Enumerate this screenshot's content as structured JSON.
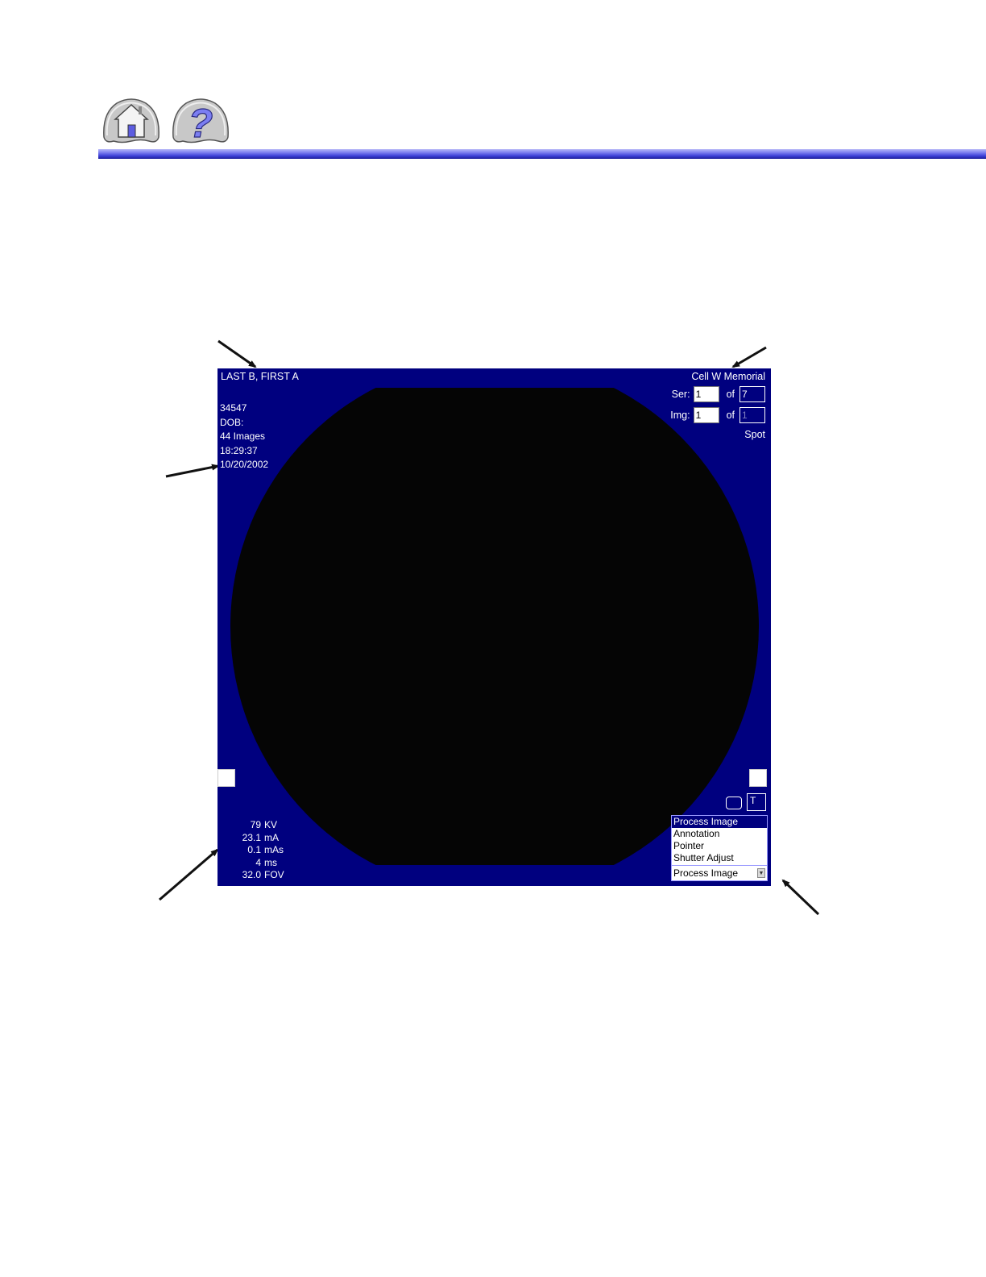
{
  "nav": {
    "home_icon": "home-icon",
    "help_icon": "question-icon",
    "help_glyph": "?"
  },
  "viewer": {
    "patient_name": "LAST B, FIRST A",
    "patient_info": [
      "34547",
      "DOB:",
      "44 Images",
      "18:29:37",
      "10/20/2002"
    ],
    "facility": "Cell W Memorial",
    "series": {
      "label": "Ser:",
      "current": "1",
      "of_label": "of",
      "total": "7"
    },
    "image": {
      "label": "Img:",
      "current": "1",
      "of_label": "of",
      "total": "1"
    },
    "mode": "Spot",
    "t_button": "T",
    "technique": [
      {
        "value": "79",
        "unit": "KV"
      },
      {
        "value": "23.1",
        "unit": "mA"
      },
      {
        "value": "0.1",
        "unit": "mAs"
      },
      {
        "value": "4",
        "unit": "ms"
      },
      {
        "value": "32.0",
        "unit": "FOV"
      }
    ],
    "tools": {
      "options": [
        "Process Image",
        "Annotation",
        "Pointer",
        "Shutter Adjust"
      ],
      "selected": "Process Image"
    }
  },
  "colors": {
    "viewer_bg": "#00007f",
    "image_bg": "#050505",
    "header_bar": "#3c3fd8"
  }
}
